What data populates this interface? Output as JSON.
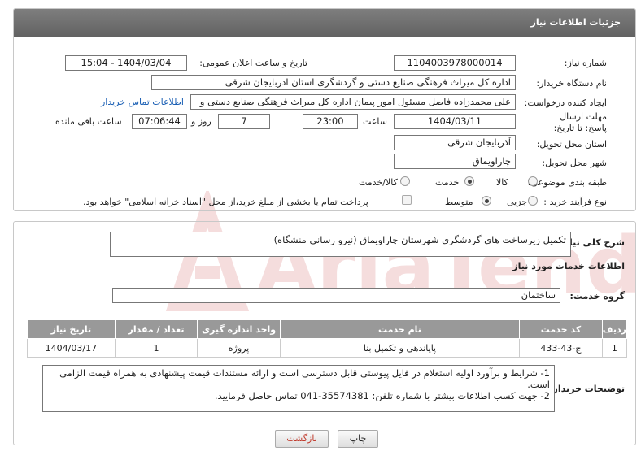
{
  "header": {
    "title": "جزئیات اطلاعات نیاز"
  },
  "fields": {
    "need_number_label": "شماره نیاز:",
    "need_number": "1104003978000014",
    "announce_label": "تاریخ و ساعت اعلان عمومی:",
    "announce_value": "1404/03/04 - 15:04",
    "buyer_org_label": "نام دستگاه خریدار:",
    "buyer_org": "اداره کل میراث فرهنگی  صنایع دستی و گردشگری استان اذربایجان شرقی",
    "creator_label": "ایجاد کننده درخواست:",
    "creator": "علی محمدزاده فاضل مسئول امور پیمان اداره کل میراث فرهنگی  صنایع دستی و",
    "contact_link": "اطلاعات تماس خریدار",
    "deadline_label": "مهلت ارسال پاسخ: تا تاریخ:",
    "deadline_date": "1404/03/11",
    "time_label": "ساعت",
    "deadline_time": "23:00",
    "days_value": "7",
    "days_label": "روز و",
    "remaining_time": "07:06:44",
    "remaining_label": "ساعت باقی مانده",
    "province_label": "استان محل تحویل:",
    "province": "آذربایجان شرقی",
    "city_label": "شهر محل تحویل:",
    "city": "چاراویماق",
    "category_label": "طبقه بندی موضوعی:",
    "category_options": [
      "کالا",
      "خدمت",
      "کالا/خدمت"
    ],
    "category_selected": "خدمت",
    "process_label": "نوع فرآیند خرید :",
    "process_options": [
      "جزیی",
      "متوسط"
    ],
    "process_selected": "متوسط",
    "payment_note": "پرداخت تمام یا بخشی از مبلغ خرید،از محل \"اسناد خزانه اسلامی\" خواهد بود."
  },
  "summary": {
    "label": "شرح کلی نیاز:",
    "value": "تکمیل زیرساخت های گردشگری شهرستان چاراویماق (نیرو رسانی منشگاه)"
  },
  "services": {
    "heading": "اطلاعات خدمات مورد نیاز",
    "group_label": "گروه خدمت:",
    "group_value": "ساختمان",
    "columns": [
      "ردیف",
      "کد خدمت",
      "نام خدمت",
      "واحد اندازه گیری",
      "تعداد / مقدار",
      "تاریخ نیاز"
    ],
    "rows": [
      [
        "1",
        "ج-43-433",
        "پایاندهی و تکمیل بنا",
        "پروژه",
        "1",
        "1404/03/17"
      ]
    ]
  },
  "notes": {
    "label": "توضیحات خریدار:",
    "line1": "1- شرایط و برآورد اولیه استعلام در فایل پیوستی قابل دسترسی است و ارائه مستندات قیمت پیشنهادی به همراه قیمت الزامی است.",
    "line2": "2- جهت کسب اطلاعات بیشتر  با شماره تلفن: 35574381-041  تماس حاصل فرمایید."
  },
  "buttons": {
    "print": "چاپ",
    "back": "بازگشت"
  },
  "watermark": "AriaTender.net",
  "colors": {
    "header_bg": "#6e6e6e",
    "table_header": "#999999",
    "link": "#1a5fb4",
    "back_text": "#c0392b"
  }
}
